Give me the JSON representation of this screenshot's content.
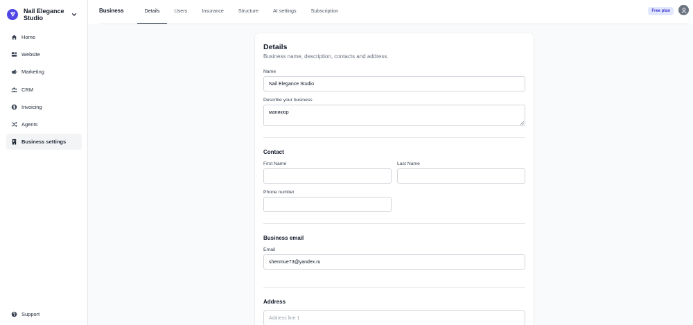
{
  "sidebar": {
    "brand_name": "Nail Elegance Studio",
    "items": [
      {
        "label": "Home",
        "icon": "home-icon"
      },
      {
        "label": "Website",
        "icon": "website-icon"
      },
      {
        "label": "Marketing",
        "icon": "megaphone-icon"
      },
      {
        "label": "CRM",
        "icon": "users-icon"
      },
      {
        "label": "Invoicing",
        "icon": "invoice-icon"
      },
      {
        "label": "Agents",
        "icon": "shuffle-icon"
      },
      {
        "label": "Business settings",
        "icon": "building-icon",
        "active": true
      }
    ],
    "support_label": "Support"
  },
  "header": {
    "title": "Business",
    "tabs": [
      {
        "label": "Details",
        "active": true
      },
      {
        "label": "Users"
      },
      {
        "label": "Insurance"
      },
      {
        "label": "Structure"
      },
      {
        "label": "AI settings"
      },
      {
        "label": "Subscription"
      }
    ],
    "plan_badge": "Free plan"
  },
  "details": {
    "title": "Details",
    "subtitle": "Business name, description, contacts and address.",
    "name_label": "Name",
    "name_value": "Nail Elegance Studio",
    "describe_label": "Describe your business",
    "describe_value": "маникюр"
  },
  "contact": {
    "title": "Contact",
    "first_name_label": "First Name",
    "first_name_value": "",
    "last_name_label": "Last Name",
    "last_name_value": "",
    "phone_label": "Phone number",
    "phone_value": ""
  },
  "business_email": {
    "title": "Business email",
    "email_label": "Email",
    "email_value": "shenmue73@yandex.ru"
  },
  "address": {
    "title": "Address",
    "line1_placeholder": "Address line 1"
  },
  "colors": {
    "accent": "#4f46e5",
    "badge_bg": "#e0e7ff",
    "badge_text": "#4338ca"
  }
}
